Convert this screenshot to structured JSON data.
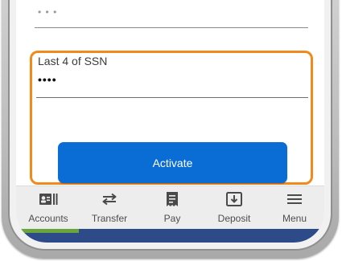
{
  "previous_field": {
    "masked_value": "• • •"
  },
  "ssn_field": {
    "label": "Last 4 of SSN",
    "masked_value": "••••"
  },
  "activate_button": {
    "label": "Activate"
  },
  "tabbar": {
    "items": [
      {
        "label": "Accounts",
        "icon": "accounts-icon"
      },
      {
        "label": "Transfer",
        "icon": "transfer-icon"
      },
      {
        "label": "Pay",
        "icon": "pay-icon"
      },
      {
        "label": "Deposit",
        "icon": "deposit-icon"
      },
      {
        "label": "Menu",
        "icon": "menu-icon"
      }
    ]
  },
  "colors": {
    "highlight_border": "#f28a1b",
    "primary_button": "#0a6dd6",
    "tabbar_background": "#ededed",
    "bottom_strip": "#2d4b88",
    "bottom_strip_accent": "#6aa53b"
  }
}
